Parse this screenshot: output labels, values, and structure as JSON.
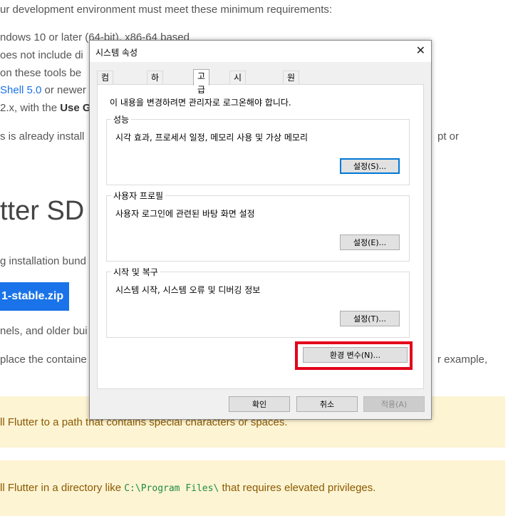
{
  "background": {
    "intro": "ur development environment must meet these minimum requirements:",
    "req1": "ndows 10 or later (64-bit), x86-64 based",
    "req2": "oes not include di",
    "req3": "on these tools be",
    "req4_link": "Shell 5.0",
    "req4_rest": " or newer",
    "req5_pre": "2.x, with the ",
    "req5_bold": "Use G",
    "already": "s is already install",
    "already_right": "pt or",
    "heading": "tter SD",
    "bundle": "g installation bund",
    "download_btn": "1-stable.zip",
    "channels": "nels, and older bui",
    "place": "place the containe",
    "place_right": "r example,",
    "note1": "ll Flutter to a path that contains special characters or spaces.",
    "note2_pre": "ll Flutter in a directory like ",
    "note2_code": "C:\\Program Files\\",
    "note2_post": " that requires elevated privileges."
  },
  "dialog": {
    "title": "시스템 속성",
    "close": "✕",
    "tabs": [
      "컴퓨터 이름",
      "하드웨어",
      "고급",
      "시스템 보호",
      "원격"
    ],
    "active_tab": "고급",
    "admin_notice": "이 내용을 변경하려면 관리자로 로그온해야 합니다.",
    "performance": {
      "label": "성능",
      "desc": "시각 효과, 프로세서 일정, 메모리 사용 및 가상 메모리",
      "button": "설정(S)..."
    },
    "profile": {
      "label": "사용자 프로필",
      "desc": "사용자 로그인에 관련된 바탕 화면 설정",
      "button": "설정(E)..."
    },
    "startup": {
      "label": "시작 및 복구",
      "desc": "시스템 시작, 시스템 오류 및 디버깅 정보",
      "button": "설정(T)..."
    },
    "env_button": "환경 변수(N)...",
    "ok": "확인",
    "cancel": "취소",
    "apply": "적용(A)",
    "highlight_color": "#e3001b"
  }
}
